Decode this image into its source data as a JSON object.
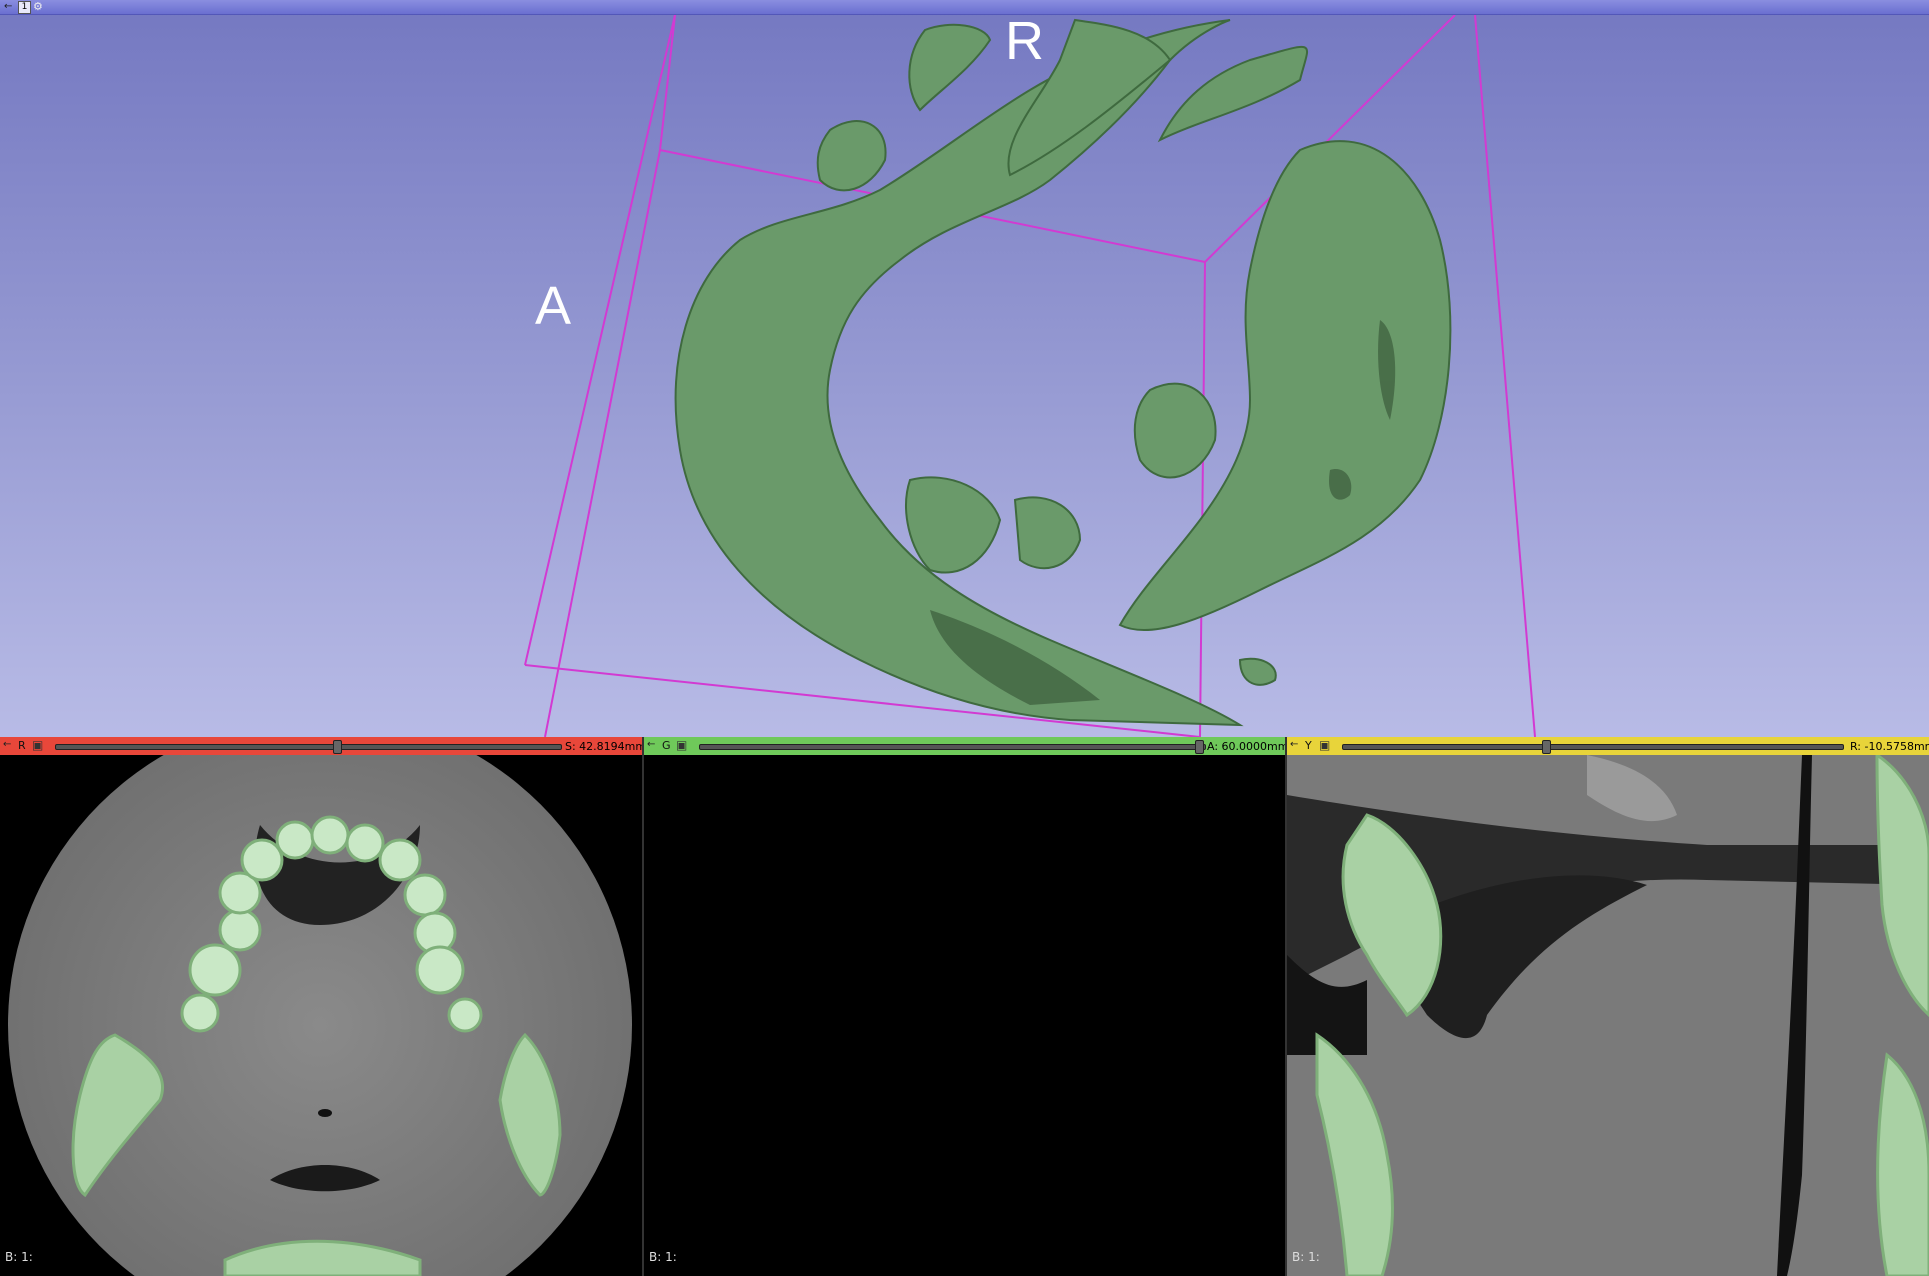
{
  "layout": {
    "view3d": {
      "view_number": "1",
      "orientation_labels": {
        "top": "R",
        "left": "A"
      },
      "background_color_top": "#7478c1",
      "background_color_bottom": "#b8bbe6",
      "model_color": "#6a9a6a",
      "bounding_box_color": "#d23ad2"
    },
    "slices": [
      {
        "id": "red",
        "letter": "R",
        "bar_color": "#e8473a",
        "coordinate": "S: 42.8194mm",
        "slider_position": 0.55,
        "footer": "B: 1:"
      },
      {
        "id": "green",
        "letter": "G",
        "bar_color": "#6fc95a",
        "coordinate": "A: 60.0000mm",
        "slider_position": 0.99,
        "footer": "B: 1:"
      },
      {
        "id": "yellow",
        "letter": "Y",
        "bar_color": "#e8d43a",
        "coordinate": "R: -10.5758mm",
        "slider_position": 0.42,
        "footer": "B: 1:"
      }
    ]
  },
  "icons": {
    "pin": "pin-icon",
    "view_options": "gear-icon",
    "slice_link": "link-icon"
  }
}
